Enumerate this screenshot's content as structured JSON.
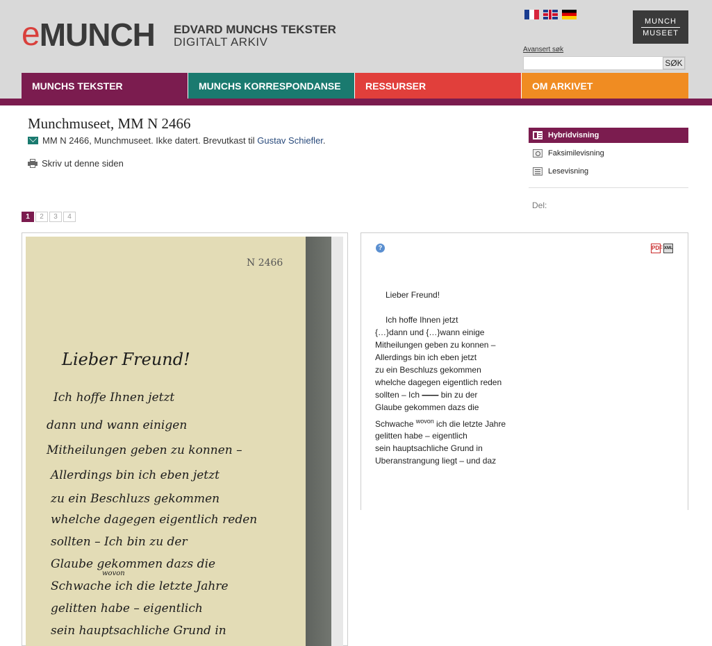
{
  "header": {
    "logo_e": "e",
    "logo_munch": "MUNCH",
    "subtitle_line1": "EDVARD MUNCHS TEKSTER",
    "subtitle_line2": "DIGITALT ARKIV",
    "museum_logo_line1": "MUNCH",
    "museum_logo_line2": "MUSEET",
    "advanced_search": "Avansert søk",
    "search_placeholder": "",
    "search_button": "SØK",
    "flags": [
      "french-flag",
      "uk-flag",
      "german-flag"
    ]
  },
  "nav": {
    "items": [
      {
        "label": "MUNCHS TEKSTER",
        "color": "#7b1c4f"
      },
      {
        "label": "MUNCHS KORRESPONDANSE",
        "color": "#1a7a6f"
      },
      {
        "label": "RESSURSER",
        "color": "#e13f3b"
      },
      {
        "label": "OM ARKIVET",
        "color": "#f08c22"
      }
    ]
  },
  "document": {
    "title": "Munchmuseet, MM N 2466",
    "meta_text": "MM N 2466, Munchmuseet. Ikke datert. Brevutkast til",
    "recipient": "Gustav Schiefler",
    "meta_end": ".",
    "print_label": "Skriv ut denne siden"
  },
  "pager": {
    "pages": [
      "1",
      "2",
      "3",
      "4"
    ],
    "active": "1"
  },
  "sidebar": {
    "views": [
      {
        "label": "Hybridvisning",
        "icon": "hybrid-view-icon",
        "active": true
      },
      {
        "label": "Faksimilevisning",
        "icon": "facsimile-view-icon",
        "active": false
      },
      {
        "label": "Lesevisning",
        "icon": "reading-view-icon",
        "active": false
      }
    ],
    "del_label": "Del:"
  },
  "facsimile": {
    "archive_number": "N 2466",
    "handwriting": [
      "Lieber Freund!",
      "Ich hoffe Ihnen jetzt",
      "dann und wann einigen",
      "Mitheilungen geben zu konnen –",
      "Allerdings bin ich eben jetzt",
      "zu ein Beschluzs gekommen",
      "whelche dagegen eigentlich reden",
      "sollten – Ich bin zu der",
      "Glaube gekommen dazs die",
      "wovon",
      "Schwache ich die letzte Jahre",
      "gelitten habe – eigentlich",
      "sein hauptsachliche Grund in"
    ]
  },
  "transcription": {
    "help_icon": "?",
    "pdf_label": "PDF",
    "xml_label": "XML",
    "greeting": "Lieber Freund!",
    "line1": "Ich hoffe Ihnen jetzt",
    "line2": "{…}dann und {…}wann einige",
    "line3": "Mitheilungen geben zu konnen –",
    "line4": "Allerdings bin ich eben jetzt",
    "line5": "zu ein Beschluzs gekommen",
    "line6": "whelche dagegen eigentlich reden",
    "line7a": "sollten – Ich ",
    "line7b": "――",
    "line7c": " bin zu der",
    "line8": "Glaube gekommen dazs die",
    "line9a": "Schwache ",
    "line9sup": "wovon",
    "line9b": " ich die letzte Jahre",
    "line10": "gelitten habe – eigentlich",
    "line11": "sein hauptsachliche Grund in",
    "line12": "Uberanstrangung liegt – und daz"
  }
}
